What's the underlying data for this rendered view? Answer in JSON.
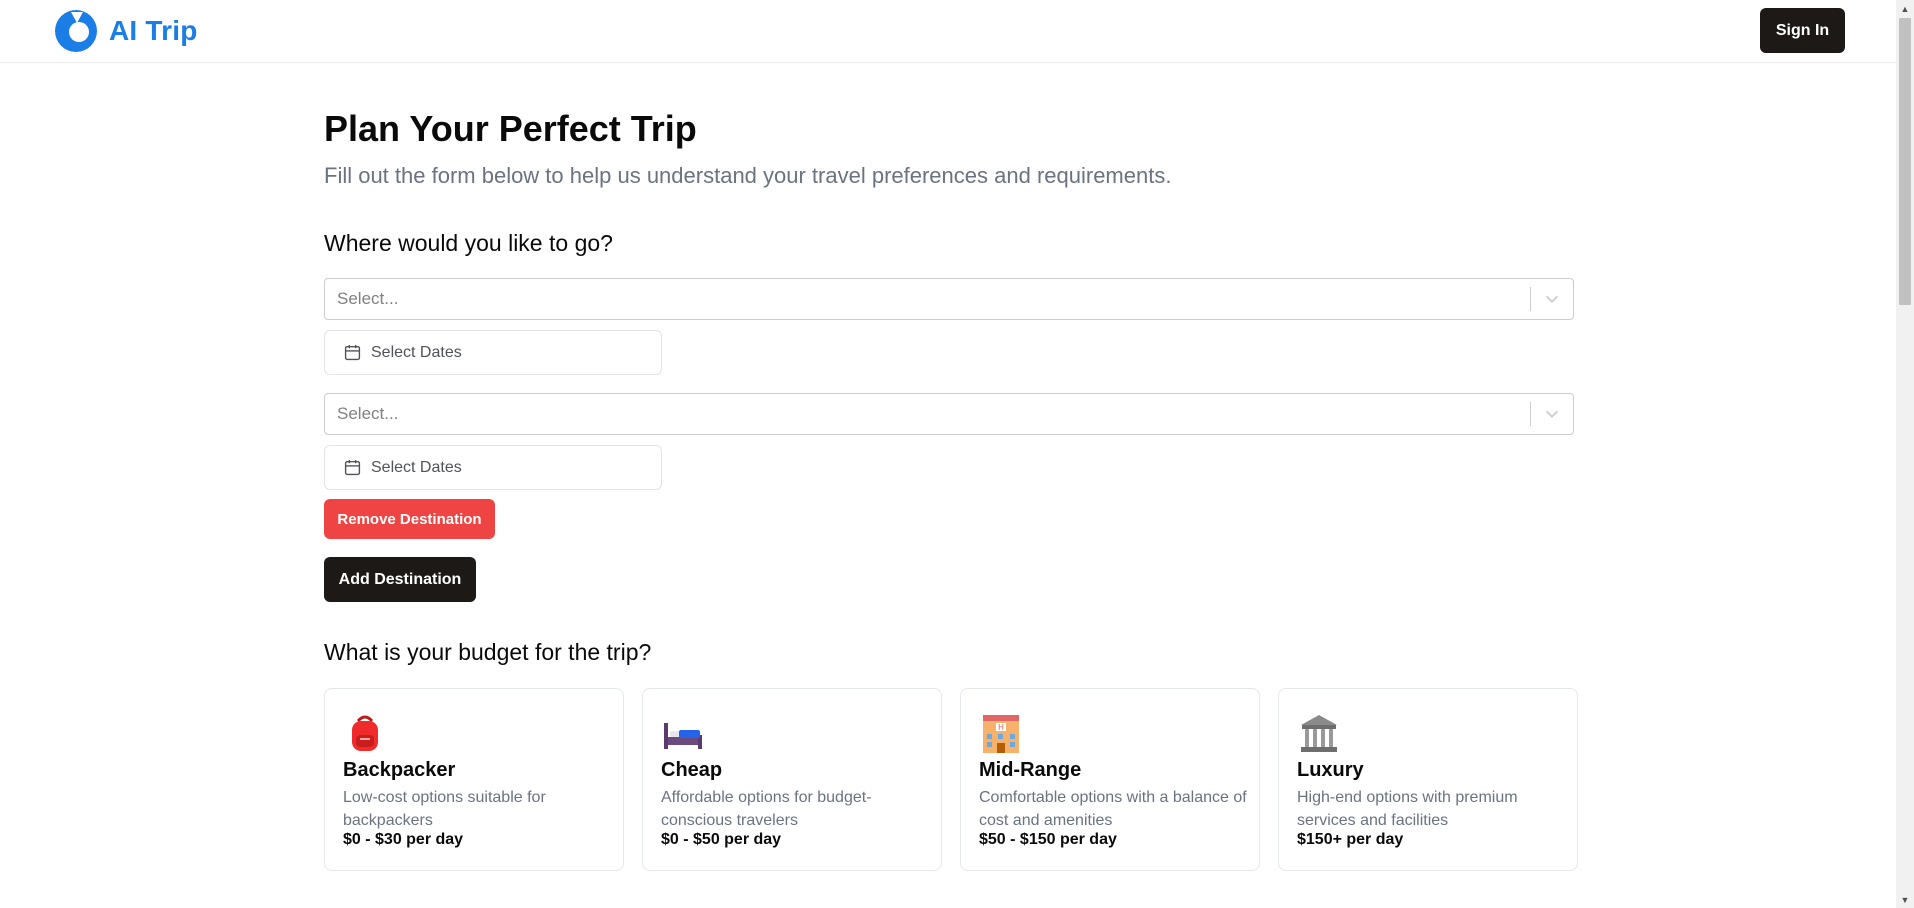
{
  "header": {
    "brand": "AI Trip",
    "sign_in_label": "Sign In"
  },
  "page": {
    "title": "Plan Your Perfect Trip",
    "subtitle": "Fill out the form below to help us understand your travel preferences and requirements."
  },
  "destinations": {
    "question": "Where would you like to go?",
    "items": [
      {
        "select_placeholder": "Select...",
        "dates_label": "Select Dates"
      },
      {
        "select_placeholder": "Select...",
        "dates_label": "Select Dates"
      }
    ],
    "remove_label": "Remove Destination",
    "add_label": "Add Destination"
  },
  "budget": {
    "question": "What is your budget for the trip?",
    "options": [
      {
        "icon": "backpack-icon",
        "title": "Backpacker",
        "description": "Low-cost options suitable for backpackers",
        "price": "$0 - $30 per day"
      },
      {
        "icon": "bed-icon",
        "title": "Cheap",
        "description": "Affordable options for budget-conscious travelers",
        "price": "$0 - $50 per day"
      },
      {
        "icon": "hotel-icon",
        "title": "Mid-Range",
        "description": "Comfortable options with a balance of cost and amenities",
        "price": "$50 - $150 per day"
      },
      {
        "icon": "classical-building-icon",
        "title": "Luxury",
        "description": "High-end options with premium services and facilities",
        "price": "$150+ per day"
      }
    ]
  },
  "colors": {
    "brand": "#1a7ee6",
    "primary_button": "#1c1917",
    "danger_button": "#ef4444",
    "muted_text": "#6b7280"
  }
}
